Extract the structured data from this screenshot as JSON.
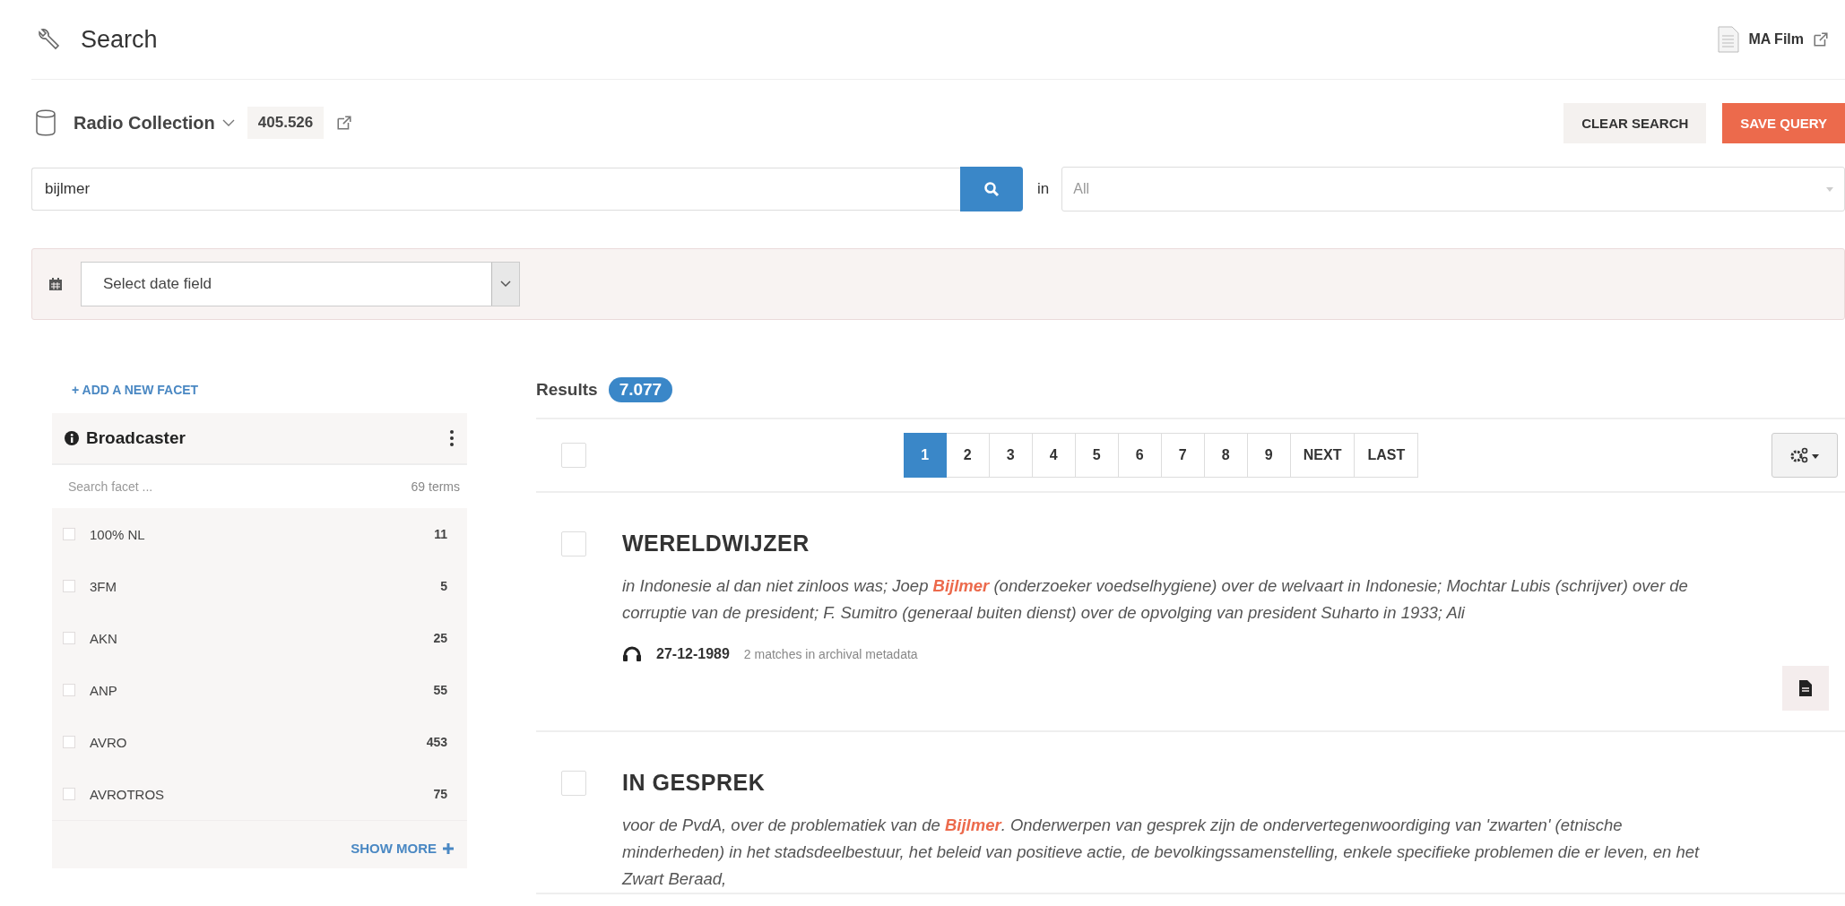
{
  "header": {
    "title": "Search",
    "document_link": "MA Film"
  },
  "collection": {
    "name": "Radio Collection",
    "count": "405.526"
  },
  "actions": [
    {
      "label": "CLEAR SEARCH",
      "kind": "secondary"
    },
    {
      "label": "SAVE QUERY",
      "kind": "primary"
    }
  ],
  "search": {
    "value": "bijlmer",
    "in_label": "in",
    "field": "All"
  },
  "date_filter": {
    "placeholder": "Select date field"
  },
  "facets": {
    "add_label": "+ ADD A NEW FACET",
    "panel": {
      "title": "Broadcaster",
      "search_placeholder": "Search facet ...",
      "terms": "69 terms",
      "show_more": "SHOW MORE",
      "items": [
        {
          "label": "100% NL",
          "count": "11",
          "checked": false
        },
        {
          "label": "3FM",
          "count": "5",
          "checked": false
        },
        {
          "label": "AKN",
          "count": "25",
          "checked": false
        },
        {
          "label": "ANP",
          "count": "55",
          "checked": false
        },
        {
          "label": "AVRO",
          "count": "453",
          "checked": false
        },
        {
          "label": "AVROTROS",
          "count": "75",
          "checked": false
        }
      ]
    }
  },
  "results": {
    "label": "Results",
    "count": "7.077",
    "select_all": false,
    "pages": [
      {
        "label": "1",
        "selected": true
      },
      {
        "label": "2",
        "selected": false
      },
      {
        "label": "3",
        "selected": false
      },
      {
        "label": "4",
        "selected": false
      },
      {
        "label": "5",
        "selected": false
      },
      {
        "label": "6",
        "selected": false
      },
      {
        "label": "7",
        "selected": false
      },
      {
        "label": "8",
        "selected": false
      },
      {
        "label": "9",
        "selected": false
      },
      {
        "label": "NEXT",
        "selected": false
      },
      {
        "label": "LAST",
        "selected": false
      }
    ],
    "items": [
      {
        "title": "WERELDWIJZER",
        "selected": false,
        "snippet": "in Indonesie al dan niet zinloos was; Joep **Bijlmer** (onderzoeker voedselhygiene) over de welvaart in Indonesie; Mochtar Lubis (schrijver) over de corruptie van de president; F. Sumitro (generaal buiten dienst) over de opvolging van president Suharto in 1933; Ali",
        "date": "27-12-1989",
        "matches": "2 matches in archival metadata"
      },
      {
        "title": "IN GESPREK",
        "selected": false,
        "snippet": "voor de PvdA, over de problematiek van de **Bijlmer**. Onderwerpen van gesprek zijn de ondervertegenwoordiging van 'zwarten' (etnische minderheden) in het stadsdeelbestuur, het beleid van positieve actie, de bevolkingssamenstelling, enkele specifieke problemen die er leven, en het Zwart Beraad,"
      }
    ]
  }
}
